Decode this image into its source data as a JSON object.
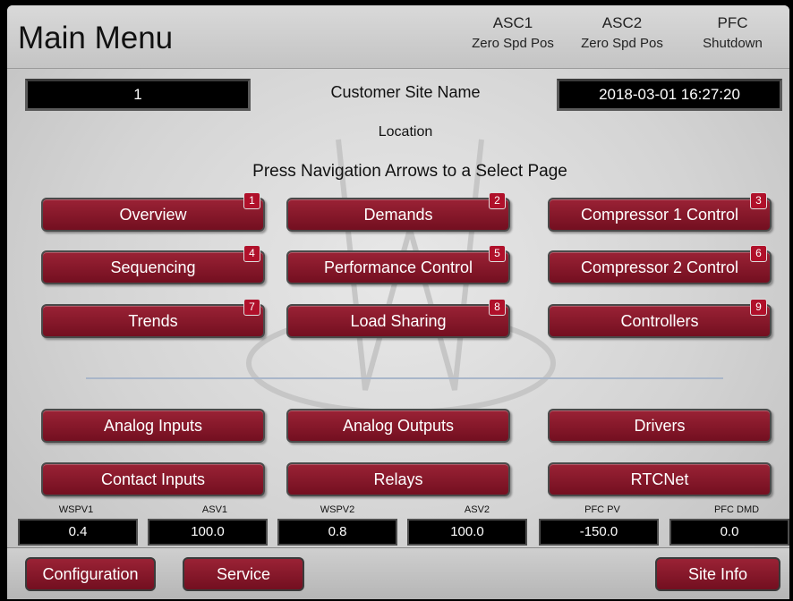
{
  "header": {
    "title": "Main Menu",
    "status": [
      {
        "line1": "ASC1",
        "line2": "Zero Spd Pos"
      },
      {
        "line1": "ASC2",
        "line2": "Zero Spd Pos"
      },
      {
        "line1": "PFC",
        "line2": "Shutdown"
      }
    ]
  },
  "info": {
    "site_number": "1",
    "site_name": "Customer Site Name",
    "datetime": "2018-03-01  16:27:20",
    "location": "Location",
    "instruction": "Press Navigation Arrows to a Select Page"
  },
  "nav_buttons": [
    {
      "label": "Overview",
      "badge": "1"
    },
    {
      "label": "Demands",
      "badge": "2"
    },
    {
      "label": "Compressor 1 Control",
      "badge": "3"
    },
    {
      "label": "Sequencing",
      "badge": "4"
    },
    {
      "label": "Performance Control",
      "badge": "5"
    },
    {
      "label": "Compressor 2 Control",
      "badge": "6"
    },
    {
      "label": "Trends",
      "badge": "7"
    },
    {
      "label": "Load Sharing",
      "badge": "8"
    },
    {
      "label": "Controllers",
      "badge": "9"
    }
  ],
  "io_buttons": [
    {
      "label": "Analog Inputs"
    },
    {
      "label": "Analog Outputs"
    },
    {
      "label": "Drivers"
    },
    {
      "label": "Contact Inputs"
    },
    {
      "label": "Relays"
    },
    {
      "label": "RTCNet"
    }
  ],
  "metrics": [
    {
      "label": "WSPV1",
      "value": "0.4"
    },
    {
      "label": "ASV1",
      "value": "100.0"
    },
    {
      "label": "WSPV2",
      "value": "0.8"
    },
    {
      "label": "ASV2",
      "value": "100.0"
    },
    {
      "label": "PFC PV",
      "value": "-150.0"
    },
    {
      "label": "PFC DMD",
      "value": "0.0"
    }
  ],
  "footer": {
    "configuration": "Configuration",
    "service": "Service",
    "site_info": "Site Info"
  },
  "colors": {
    "button": "#8a1a2d",
    "button_badge": "#b0102a",
    "screen_bg": "#d6d6d6"
  }
}
